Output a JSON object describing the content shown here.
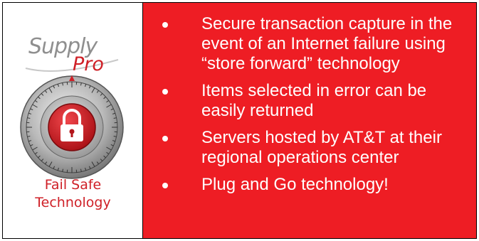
{
  "logo": {
    "word1": "Supply",
    "word2": "Pro",
    "icon": "vault-lock-icon"
  },
  "caption": {
    "line1": "Fail Safe",
    "line2": "Technology"
  },
  "features": [
    "Secure transaction capture in the event of an Internet failure using “store forward” technology",
    "Items selected in error can be easily returned",
    "Servers hosted by AT&T at their regional operations center",
    "Plug and Go technology!"
  ],
  "colors": {
    "panel_red": "#ee1d24",
    "logo_red": "#cf2027",
    "logo_gray": "#8f8f8f"
  }
}
